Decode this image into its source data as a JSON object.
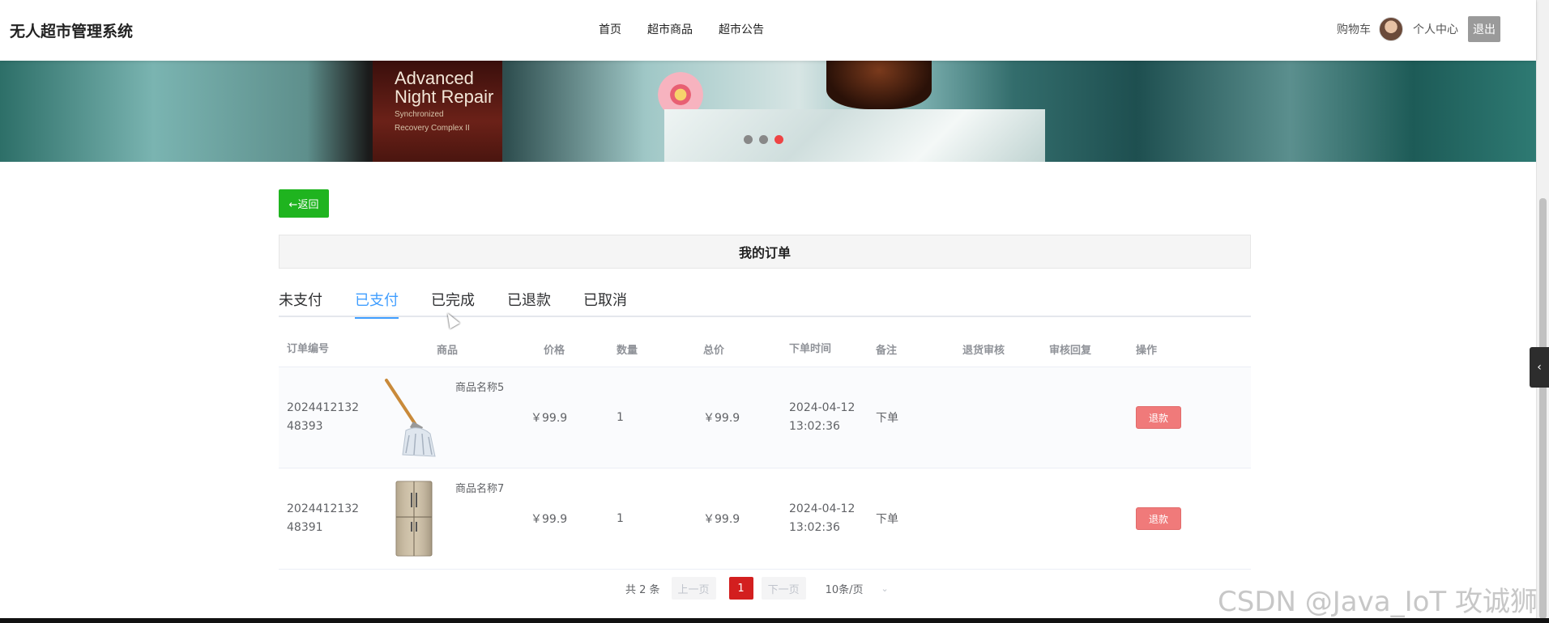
{
  "header": {
    "logo": "无人超市管理系统",
    "nav": [
      "首页",
      "超市商品",
      "超市公告"
    ],
    "cart": "购物车",
    "user_center": "个人中心",
    "logout": "退出"
  },
  "banner": {
    "text_line1": "Advanced",
    "text_line2": "Night Repair",
    "text_line3": "Synchronized",
    "text_line4": "Recovery Complex II",
    "slides": 3,
    "active_slide": 3
  },
  "main": {
    "back_button": "←返回",
    "title": "我的订单",
    "tabs": [
      {
        "label": "未支付",
        "active": false
      },
      {
        "label": "已支付",
        "active": true
      },
      {
        "label": "已完成",
        "active": false
      },
      {
        "label": "已退款",
        "active": false
      },
      {
        "label": "已取消",
        "active": false
      }
    ],
    "columns": [
      "订单编号",
      "商品",
      "价格",
      "数量",
      "总价",
      "下单时间",
      "备注",
      "退货审核",
      "审核回复",
      "操作"
    ],
    "rows": [
      {
        "order_no_1": "2024412132",
        "order_no_2": "48393",
        "image": "mop",
        "name": "商品名称5",
        "price": "￥99.9",
        "qty": "1",
        "total": "￥99.9",
        "date": "2024-04-12",
        "time": "13:02:36",
        "note": "下单",
        "refund_review": "",
        "review_reply": "",
        "action": "退款"
      },
      {
        "order_no_1": "2024412132",
        "order_no_2": "48391",
        "image": "fridge",
        "name": "商品名称7",
        "price": "￥99.9",
        "qty": "1",
        "total": "￥99.9",
        "date": "2024-04-12",
        "time": "13:02:36",
        "note": "下单",
        "refund_review": "",
        "review_reply": "",
        "action": "退款"
      }
    ]
  },
  "pagination": {
    "total": "共 2 条",
    "prev": "上一页",
    "current": "1",
    "next": "下一页",
    "page_size": "10条/页"
  },
  "watermark": "CSDN @Java_IoT 攻诚狮",
  "colors": {
    "accent": "#409eff",
    "back_button": "#1fb41f",
    "refund_button": "#f07a7a",
    "current_page": "#d31f1f"
  }
}
